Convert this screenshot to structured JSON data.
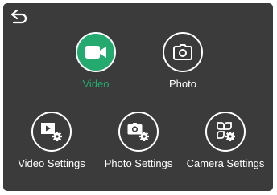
{
  "header": {
    "back_icon": "back-arrow-icon"
  },
  "menu": {
    "video": {
      "label": "Video",
      "icon": "video-camera-icon",
      "selected": true
    },
    "photo": {
      "label": "Photo",
      "icon": "camera-icon",
      "selected": false
    },
    "video_settings": {
      "label": "Video Settings",
      "icon": "video-settings-icon",
      "selected": false
    },
    "photo_settings": {
      "label": "Photo Settings",
      "icon": "photo-settings-icon",
      "selected": false
    },
    "camera_settings": {
      "label": "Camera Settings",
      "icon": "camera-settings-icon",
      "selected": false
    }
  },
  "colors": {
    "background": "#3b3b3b",
    "accent": "#24a96e",
    "foreground": "#ffffff"
  }
}
